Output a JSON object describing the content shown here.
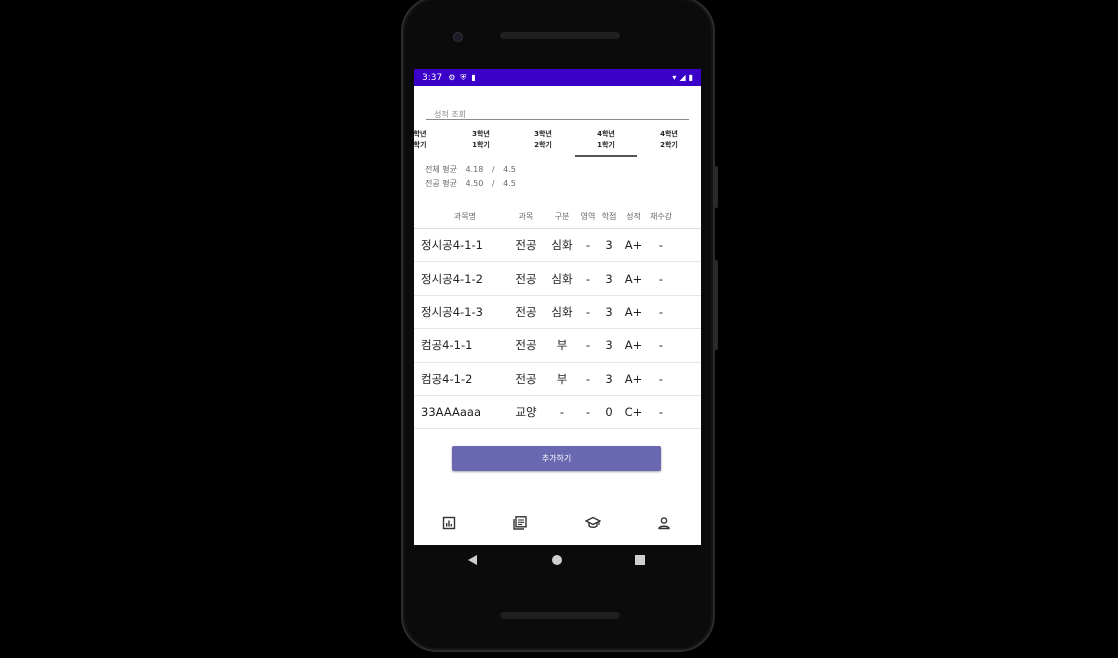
{
  "status_bar": {
    "time": "3:37"
  },
  "search": {
    "placeholder": "성적 조회"
  },
  "semester_tabs": [
    {
      "line1": "학년",
      "line2": "학기"
    },
    {
      "line1": "3학년",
      "line2": "1학기"
    },
    {
      "line1": "3학년",
      "line2": "2학기"
    },
    {
      "line1": "4학년",
      "line2": "1학기"
    },
    {
      "line1": "4학년",
      "line2": "2학기"
    }
  ],
  "averages": {
    "total_label": "전체 평균",
    "total_value": "4.18",
    "separator": "/",
    "total_max": "4.5",
    "major_label": "전공 평균",
    "major_value": "4.50",
    "major_max": "4.5"
  },
  "table": {
    "headers": [
      "과목명",
      "과목",
      "구분",
      "영역",
      "학점",
      "성적",
      "재수강"
    ],
    "rows": [
      [
        "정시공4-1-1",
        "전공",
        "심화",
        "-",
        "3",
        "A+",
        "-"
      ],
      [
        "정시공4-1-2",
        "전공",
        "심화",
        "-",
        "3",
        "A+",
        "-"
      ],
      [
        "정시공4-1-3",
        "전공",
        "심화",
        "-",
        "3",
        "A+",
        "-"
      ],
      [
        "컴공4-1-1",
        "전공",
        "부",
        "-",
        "3",
        "A+",
        "-"
      ],
      [
        "컴공4-1-2",
        "전공",
        "부",
        "-",
        "3",
        "A+",
        "-"
      ],
      [
        "33AAAaaa",
        "교양",
        "-",
        "-",
        "0",
        "C+",
        "-"
      ]
    ]
  },
  "add_button": {
    "label": "추가하기"
  },
  "bottom_nav": [
    "chart-icon",
    "news-icon",
    "school-icon",
    "person-icon"
  ],
  "colors": {
    "status_bar": "#3a00c8",
    "button": "#6a68b0"
  }
}
